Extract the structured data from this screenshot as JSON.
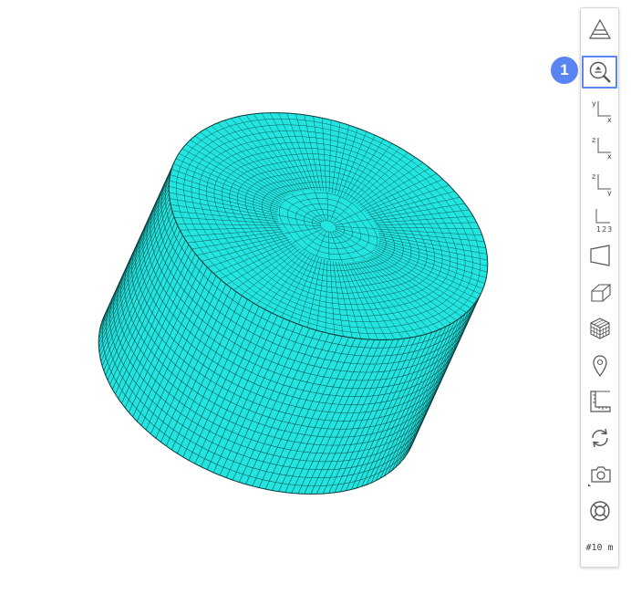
{
  "colors": {
    "mesh_fill": "#22e5e0",
    "mesh_line": "#0b3b3b",
    "accent": "#5a84f2",
    "icon": "#555555"
  },
  "toolbar": {
    "items": [
      {
        "name": "fit-view-icon"
      },
      {
        "name": "zoom-region-icon",
        "active": true
      },
      {
        "name": "view-xy-icon",
        "axis_top": "y",
        "axis_right": "x"
      },
      {
        "name": "view-zx-icon",
        "axis_top": "z",
        "axis_right": "x"
      },
      {
        "name": "view-zy-icon",
        "axis_top": "z",
        "axis_right": "y"
      },
      {
        "name": "view-123-icon",
        "axis_label": "123"
      },
      {
        "name": "perspective-icon"
      },
      {
        "name": "iso-view-icon"
      },
      {
        "name": "shaded-cube-icon"
      },
      {
        "name": "location-pin-icon"
      },
      {
        "name": "ruler-icon"
      },
      {
        "name": "rotate-icon"
      },
      {
        "name": "camera-icon"
      },
      {
        "name": "lifebuoy-icon"
      },
      {
        "name": "mesh-size-label",
        "label": "#10 m"
      }
    ]
  },
  "callout": {
    "number": "1"
  }
}
